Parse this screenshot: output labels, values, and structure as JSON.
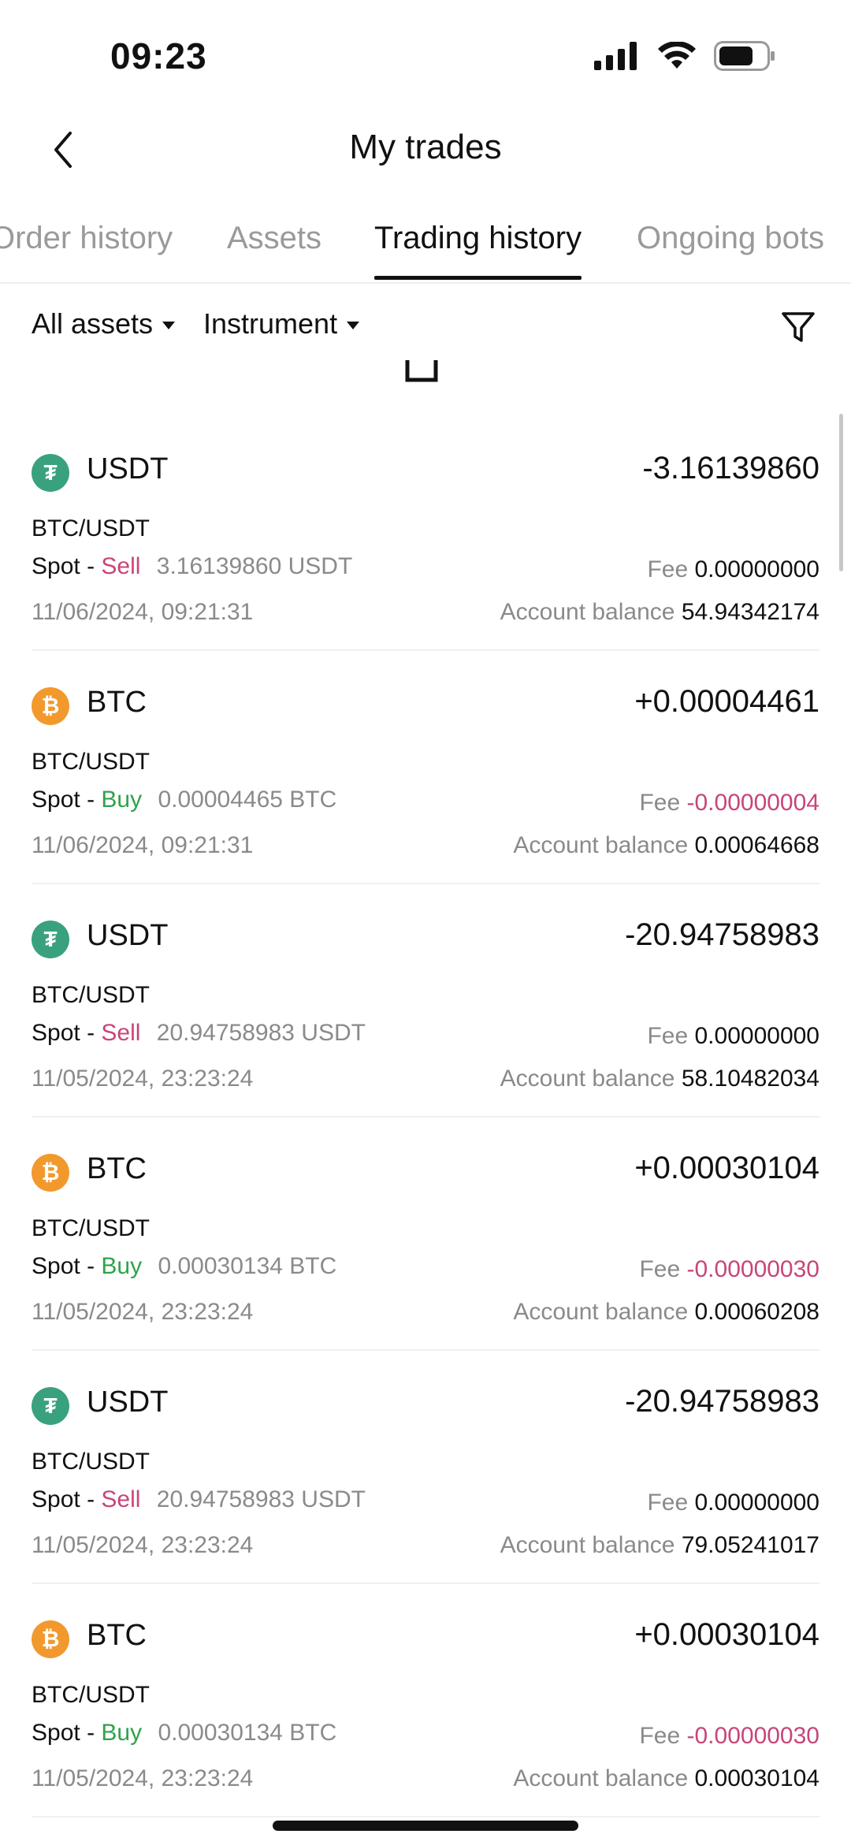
{
  "status": {
    "time": "09:23"
  },
  "header": {
    "title": "My trades"
  },
  "tabs": [
    {
      "label": "Order history"
    },
    {
      "label": "Assets"
    },
    {
      "label": "Trading history"
    },
    {
      "label": "Ongoing bots"
    }
  ],
  "active_tab": "Trading history",
  "filters": {
    "assets": "All assets",
    "instrument": "Instrument"
  },
  "labels": {
    "fee": "Fee",
    "balance": "Account balance",
    "dash": "-"
  },
  "trades": [
    {
      "coin": "USDT",
      "icon": "tether-icon",
      "amount": "-3.16139860",
      "pair": "BTC/USDT",
      "market": "Spot",
      "side": "Sell",
      "quantity": "3.16139860 USDT",
      "datetime": "11/06/2024, 09:21:31",
      "fee": "0.00000000",
      "balance": "54.94342174"
    },
    {
      "coin": "BTC",
      "icon": "bitcoin-icon",
      "amount": "+0.00004461",
      "pair": "BTC/USDT",
      "market": "Spot",
      "side": "Buy",
      "quantity": "0.00004465 BTC",
      "datetime": "11/06/2024, 09:21:31",
      "fee": "-0.00000004",
      "balance": "0.00064668"
    },
    {
      "coin": "USDT",
      "icon": "tether-icon",
      "amount": "-20.94758983",
      "pair": "BTC/USDT",
      "market": "Spot",
      "side": "Sell",
      "quantity": "20.94758983 USDT",
      "datetime": "11/05/2024, 23:23:24",
      "fee": "0.00000000",
      "balance": "58.10482034"
    },
    {
      "coin": "BTC",
      "icon": "bitcoin-icon",
      "amount": "+0.00030104",
      "pair": "BTC/USDT",
      "market": "Spot",
      "side": "Buy",
      "quantity": "0.00030134 BTC",
      "datetime": "11/05/2024, 23:23:24",
      "fee": "-0.00000030",
      "balance": "0.00060208"
    },
    {
      "coin": "USDT",
      "icon": "tether-icon",
      "amount": "-20.94758983",
      "pair": "BTC/USDT",
      "market": "Spot",
      "side": "Sell",
      "quantity": "20.94758983 USDT",
      "datetime": "11/05/2024, 23:23:24",
      "fee": "0.00000000",
      "balance": "79.05241017"
    },
    {
      "coin": "BTC",
      "icon": "bitcoin-icon",
      "amount": "+0.00030104",
      "pair": "BTC/USDT",
      "market": "Spot",
      "side": "Buy",
      "quantity": "0.00030134 BTC",
      "datetime": "11/05/2024, 23:23:24",
      "fee": "-0.00000030",
      "balance": "0.00030104"
    }
  ],
  "colors": {
    "sell": "#c8457a",
    "buy": "#2fa34c",
    "usdt": "#3aa17e",
    "btc": "#f2992e",
    "muted": "#8a8a8a"
  }
}
